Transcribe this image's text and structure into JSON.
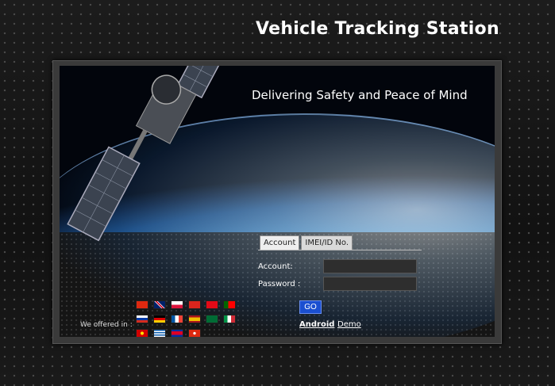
{
  "header": {
    "title": "Vehicle Tracking Station"
  },
  "hero": {
    "tagline": "Delivering Safety and Peace of Mind"
  },
  "login": {
    "tabs": [
      {
        "label": "Account"
      },
      {
        "label": "IMEI/ID No."
      }
    ],
    "account_label": "Account:",
    "password_label": "Password :",
    "account_value": "",
    "password_value": "",
    "go_label": "GO"
  },
  "links": {
    "android": "Android",
    "demo": "Demo"
  },
  "languages": {
    "label": "We offered in :",
    "flags": [
      "china-flag",
      "uk-flag",
      "poland-flag",
      "vietnam-flag",
      "turkey-flag",
      "portugal-flag",
      "russia-flag",
      "germany-flag",
      "france-flag",
      "spain-flag",
      "saudi-arabia-flag",
      "italy-flag",
      "macedonia-flag",
      "greece-flag",
      "cambodia-flag",
      "hong-kong-flag"
    ]
  },
  "colors": {
    "go_button": "#1a4fd0",
    "background": "#151515",
    "title_text": "#ffffff"
  }
}
